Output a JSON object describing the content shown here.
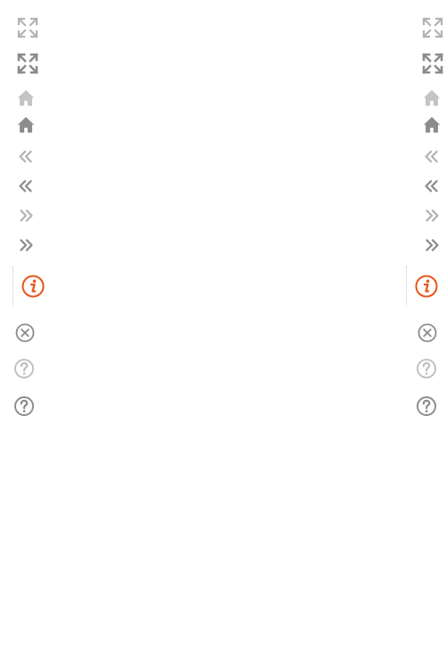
{
  "icons": {
    "fullscreen_light": "expand-arrows-icon",
    "fullscreen_dark": "expand-arrows-icon",
    "home_light": "home-icon",
    "home_dark": "home-icon",
    "rewind_light": "double-chevron-left-icon",
    "rewind_dark": "double-chevron-left-icon",
    "forward_light": "double-chevron-right-icon",
    "forward_dark": "double-chevron-right-icon",
    "info": "info-circle-icon",
    "close": "close-circle-icon",
    "help_light": "question-circle-icon",
    "help_dark": "question-circle-icon"
  },
  "colors": {
    "icon_light": "#b3b3b3",
    "icon_dark": "#8c8c8c",
    "accent": "#e8561a",
    "divider": "#c8c8c8"
  }
}
